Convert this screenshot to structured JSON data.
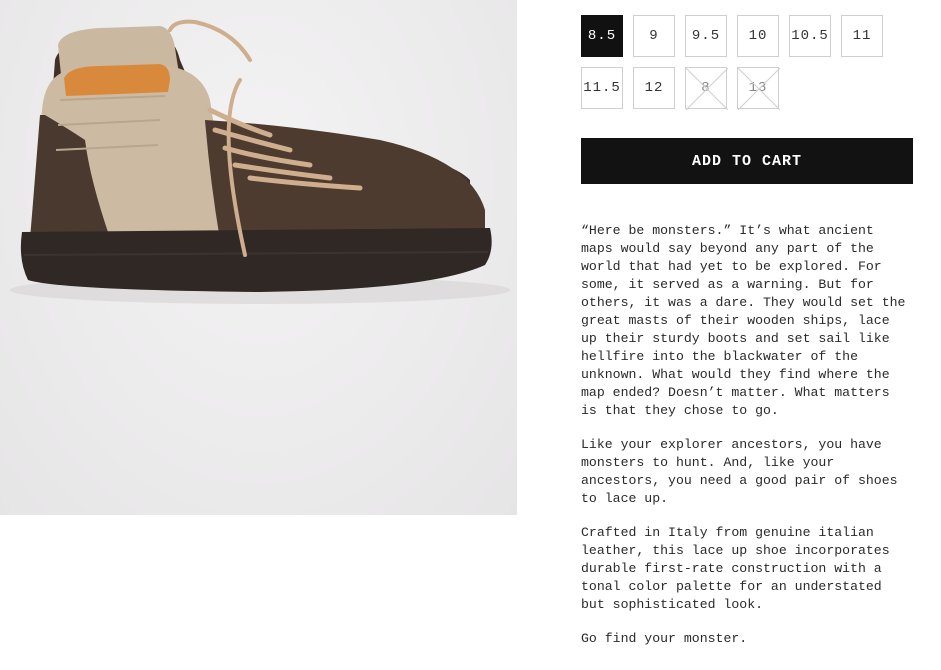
{
  "product_image": {
    "alt": "",
    "colors": {
      "background": "#ecebec",
      "leather": "#4a392f",
      "canvas": "#cbb8a0",
      "sole": "#2e2724",
      "lining": "#d88a3c",
      "laces": "#c9a98a"
    }
  },
  "sizes": [
    {
      "label": "8.5",
      "state": "selected"
    },
    {
      "label": "9",
      "state": "available"
    },
    {
      "label": "9.5",
      "state": "available"
    },
    {
      "label": "10",
      "state": "available"
    },
    {
      "label": "10.5",
      "state": "available"
    },
    {
      "label": "11",
      "state": "available"
    },
    {
      "label": "11.5",
      "state": "available"
    },
    {
      "label": "12",
      "state": "available"
    },
    {
      "label": "8",
      "state": "unavailable"
    },
    {
      "label": "13",
      "state": "unavailable"
    }
  ],
  "cart": {
    "button_label": "ADD TO CART"
  },
  "description": {
    "paragraphs": [
      "“Here be monsters.” It’s what ancient maps would say beyond any part of the world that had yet to be explored. For some, it served as a warning. But for others, it was a dare. They would set the great masts of their wooden ships, lace up their sturdy boots and set sail like hellfire into the blackwater of the unknown. What would they find where the map ended? Doesn’t matter. What matters is that they chose to go.",
      "Like your explorer ancestors, you have monsters to hunt. And, like your ancestors, you need a good pair of shoes to lace up.",
      "Crafted in Italy from genuine italian leather, this lace up shoe incorporates durable first-rate construction with a tonal color palette for an understated but sophisticated look.",
      "Go find your monster."
    ]
  }
}
